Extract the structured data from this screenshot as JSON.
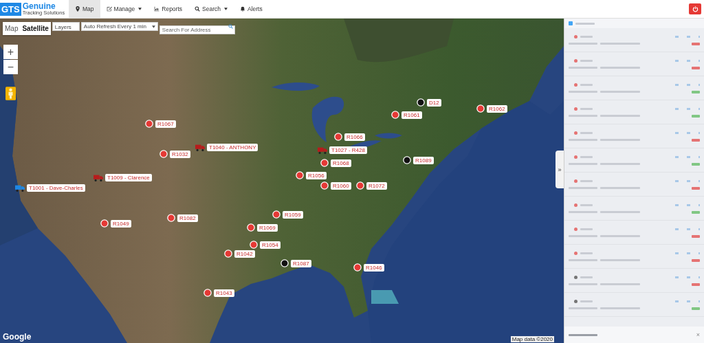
{
  "header": {
    "logo": {
      "mark": "GTS",
      "title": "Genuine",
      "subtitle": "Tracking Solutions"
    },
    "nav": [
      {
        "label": "Map",
        "selected": true,
        "dropdown": false
      },
      {
        "label": "Manage",
        "selected": false,
        "dropdown": true
      },
      {
        "label": "Reports",
        "selected": false,
        "dropdown": false
      },
      {
        "label": "Search",
        "selected": false,
        "dropdown": true
      },
      {
        "label": "Alerts",
        "selected": false,
        "dropdown": false
      }
    ]
  },
  "map_controls": {
    "map_types": [
      {
        "label": "Map",
        "selected": false
      },
      {
        "label": "Satellite",
        "selected": true
      }
    ],
    "layers_select": {
      "value": "Layers"
    },
    "refresh_select": {
      "value": "Auto Refresh Every 1 min"
    },
    "search": {
      "placeholder": "Search For Address"
    },
    "zoom": [
      "+",
      "−"
    ]
  },
  "markers": [
    {
      "kind": "dot",
      "color": "#e53935",
      "label": "R1067"
    },
    {
      "kind": "dot",
      "color": "#e53935",
      "label": "R1032"
    },
    {
      "kind": "truck",
      "color": "#b71c1c",
      "label": "T1040 - ANTHONY"
    },
    {
      "kind": "truck",
      "color": "#b71c1c",
      "label": "T1009 - Clarence"
    },
    {
      "kind": "truck",
      "color": "#1e88e5",
      "label": "T1001 - Dave-Charles"
    },
    {
      "kind": "dot",
      "color": "#e53935",
      "label": "R1049"
    },
    {
      "kind": "dot",
      "color": "#e53935",
      "label": "R1082"
    },
    {
      "kind": "dot",
      "color": "#e53935",
      "label": "R1059"
    },
    {
      "kind": "dot",
      "color": "#e53935",
      "label": "R1069"
    },
    {
      "kind": "dot",
      "color": "#e53935",
      "label": "R1054"
    },
    {
      "kind": "dot",
      "color": "#e53935",
      "label": "R1042"
    },
    {
      "kind": "dot",
      "color": "#111111",
      "label": "R1087"
    },
    {
      "kind": "dot",
      "color": "#e53935",
      "label": "R1046"
    },
    {
      "kind": "dot",
      "color": "#e53935",
      "label": "R1043"
    },
    {
      "kind": "dot",
      "color": "#111111",
      "label": "D12"
    },
    {
      "kind": "dot",
      "color": "#e53935",
      "label": "R1061"
    },
    {
      "kind": "dot",
      "color": "#e53935",
      "label": "R1066"
    },
    {
      "kind": "truck",
      "color": "#b71c1c",
      "label": "T1027 - R428"
    },
    {
      "kind": "dot",
      "color": "#e53935",
      "label": "R1068"
    },
    {
      "kind": "dot",
      "color": "#e53935",
      "label": "R1060"
    },
    {
      "kind": "dot",
      "color": "#e53935",
      "label": "R1072"
    },
    {
      "kind": "dot",
      "color": "#111111",
      "label": "R1089"
    },
    {
      "kind": "dot",
      "color": "#e53935",
      "label": "R1062"
    },
    {
      "kind": "dot",
      "color": "#e53935",
      "label": "R1056"
    }
  ],
  "attribution": {
    "logo": "Google",
    "data": "Map data ©2020"
  },
  "side_panel": {
    "collapse": "»",
    "group": {
      "color": "#42a5f5"
    },
    "rows": [
      {
        "color": "#e57373",
        "online": false
      },
      {
        "color": "#e57373",
        "online": false
      },
      {
        "color": "#e57373",
        "online": true
      },
      {
        "color": "#e57373",
        "online": true
      },
      {
        "color": "#e57373",
        "online": false
      },
      {
        "color": "#e57373",
        "online": true
      },
      {
        "color": "#e57373",
        "online": false
      },
      {
        "color": "#e57373",
        "online": true
      },
      {
        "color": "#e57373",
        "online": false
      },
      {
        "color": "#e57373",
        "online": false
      },
      {
        "color": "#757575",
        "online": false
      },
      {
        "color": "#757575",
        "online": true
      }
    ],
    "footer": {
      "close": "×"
    }
  }
}
